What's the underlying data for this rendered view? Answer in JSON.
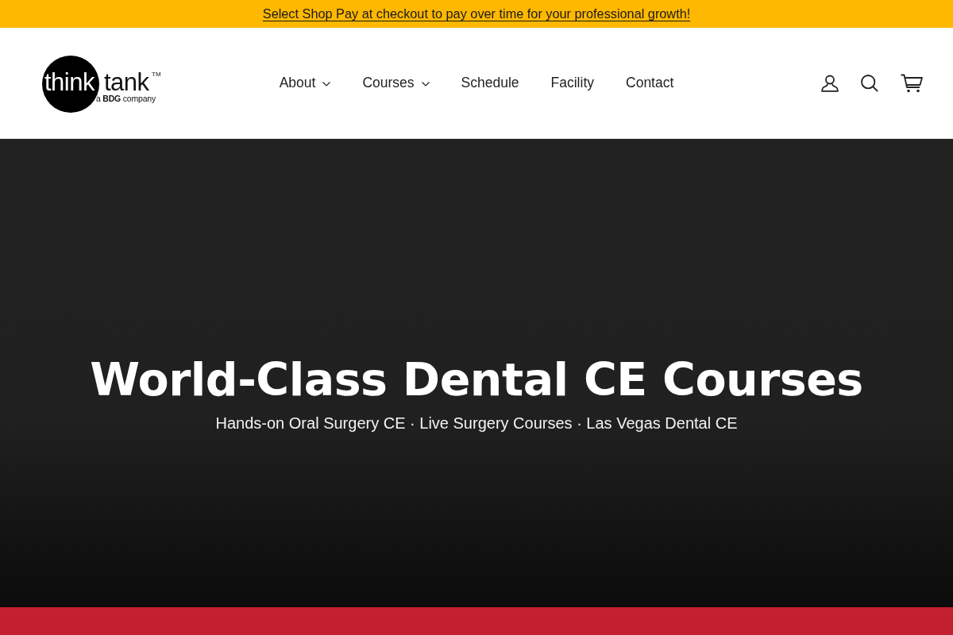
{
  "announcement": {
    "text": "Select Shop Pay at checkout to pay over time for your professional growth!"
  },
  "header": {
    "logo": {
      "word_1": "think",
      "word_2": "tank",
      "mark": "TM",
      "tagline": "a **BDG** company"
    },
    "nav": [
      {
        "label": "About",
        "has_dropdown": true
      },
      {
        "label": "Courses",
        "has_dropdown": true
      },
      {
        "label": "Schedule",
        "has_dropdown": false
      },
      {
        "label": "Facility",
        "has_dropdown": false
      },
      {
        "label": "Contact",
        "has_dropdown": false
      }
    ]
  },
  "hero": {
    "title": "World-Class Dental CE Courses",
    "subtitle": "Hands-on Oral Surgery CE · Live Surgery Courses · Las Vegas Dental CE"
  }
}
